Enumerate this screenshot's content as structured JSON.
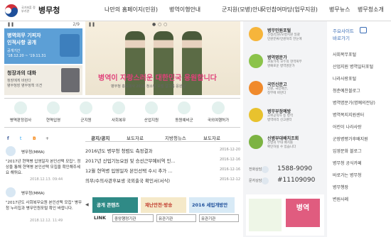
{
  "header": {
    "govt_line": "국가보훈 정부기관",
    "site_name": "병무청",
    "nav": [
      "나만의 홈페이지(민원)",
      "병역이행안내",
      "군지원(모병)안내",
      "국민참여마당(업무지원)",
      "병무뉴스",
      "병무청소개"
    ]
  },
  "left_panel": {
    "page": "2/9",
    "card1": {
      "title1": "병역의무 기피자",
      "title2": "인적사항 공개",
      "sub1": "공개기간",
      "sub2": "'18.12.20 ~ '19.11.31"
    },
    "card2": {
      "title": "청장과의 대화",
      "sub1": "청장에게 바란다",
      "sub2": "병무청장 병무정책 의견"
    }
  },
  "banner": {
    "headline": "병역이 자랑스러운 대한민국 응원합니다",
    "caption": "병무청 홍보대사 2018 청소년 모델 걸그룹 응원단"
  },
  "quick_menu": [
    {
      "label": "병역판정검사",
      "icon": "person-check-icon"
    },
    {
      "label": "현역입영",
      "icon": "soldier-icon"
    },
    {
      "label": "군지원",
      "icon": "helmet-icon"
    },
    {
      "label": "사회복무",
      "icon": "people-icon"
    },
    {
      "label": "산업지원",
      "icon": "factory-icon"
    },
    {
      "label": "동원예비군",
      "icon": "reserve-icon"
    },
    {
      "label": "국외여행허가",
      "icon": "airplane-icon"
    }
  ],
  "news": [
    {
      "source": "병무청(MMA)",
      "text": "\"2017년 현역병 입영일자 본인선택 모집\", 정상을 통해 현역병 본인선택 모집을 확인해주세요 해둬요.",
      "date": "2018.12.13. 09:44"
    },
    {
      "source": "병무청(MMA)",
      "text": "\"2017년도 사회복무요원 본인선택 모집\" 병무청 누리집과 병무민원포털 확인 바랍니다.",
      "date": "2018.12.12. 11:49"
    }
  ],
  "board": {
    "tabs": [
      "공지/공지",
      "보도자료",
      "지방청뉴스",
      "보도자료"
    ],
    "rows": [
      {
        "title": "2016년도 병무청 청렴도 측정결과",
        "date": "2016-12-20"
      },
      {
        "title": "2017년 산업기능요원 및 승선근무예비역 인...",
        "date": "2016-12-16"
      },
      {
        "title": "12월 현역병 입영일자 본인선택 수시 추가 ...",
        "date": "2016-12-16"
      },
      {
        "title": "의무/수의사관후보생 국외출국 확인서(서식)",
        "date": "2016-12-12"
      }
    ]
  },
  "ads": [
    {
      "label": "공개 콘텐츠",
      "bg": "#2f8a86"
    },
    {
      "label": "재난안전·방송",
      "bg": "#f5e9c9"
    },
    {
      "label": "2016 세입개방안",
      "bg": "#d8eaf6"
    }
  ],
  "link_bar": {
    "label": "LINK",
    "selects": [
      "중앙행정기관",
      "유관기관",
      "유관기관"
    ]
  },
  "services": [
    {
      "title": "병무민원포털",
      "s1": "신청/민원/모병지원 일괄",
      "s2": "민원분류/민원처리 한눈에",
      "color": "#f6b53b"
    },
    {
      "title": "병역명문가",
      "s1": "3대/가족 모두의 현역복무",
      "s2": "명예로운 병역명문가",
      "color": "#8bc34a"
    },
    {
      "title": "국민신문고",
      "s1": "민원, 국민제안,",
      "s2": "정부에 바란다",
      "color": "#f08a2c"
    },
    {
      "title": "병무부정예방",
      "s1": "고위공직자 등 병역",
      "s2": "병역비리 신고센터",
      "color": "#e8c22e"
    },
    {
      "title": "신병부대배치조회",
      "s1": "신병의 부대 배치를",
      "s2": "확인하실 수 있습니다",
      "color": "#7cb342"
    }
  ],
  "phones": [
    {
      "label": "전화상담",
      "number": "1588-9090"
    },
    {
      "label": "문자상담",
      "number": "#11109090"
    }
  ],
  "svc_banner": {
    "right_text": "병역"
  },
  "related": {
    "header1": "주요사이트",
    "header2": "바로가기",
    "links": [
      "사회복무포털",
      "산업지원 병역일터포털",
      "나라사랑포털",
      "청춘예찬블로그",
      "병역명문가(명예의전당)",
      "병역복지지원센터",
      "어린이 나라사랑",
      "군장병평가후배지원",
      "입영문화 블로그",
      "병무청 공식카페",
      "바로가는 병무청",
      "병무행장",
      "변원사례"
    ]
  },
  "colors": {
    "brand": "#1e4f9a",
    "banner_pink": "#e0417a",
    "quick_circle": "#e3f1ee"
  }
}
